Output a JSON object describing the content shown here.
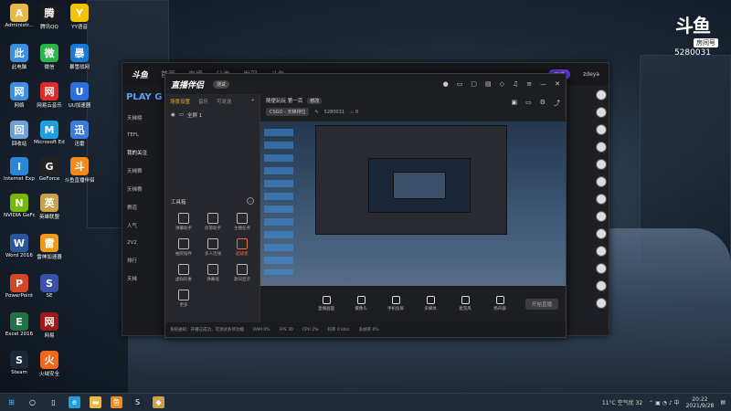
{
  "desktop": {
    "icons": [
      {
        "label": "Administr...",
        "icon": "user-folder-icon",
        "color": "#e9b94a"
      },
      {
        "label": "腾讯QQ",
        "icon": "qq-penguin-icon",
        "color": "#1a1a1a"
      },
      {
        "label": "YY语音",
        "icon": "yy-voice-icon",
        "color": "#f5c400"
      },
      {
        "label": "此电脑",
        "icon": "computer-icon",
        "color": "#3d8fe0"
      },
      {
        "label": "微信",
        "icon": "wechat-icon",
        "color": "#2ab54b"
      },
      {
        "label": "暴雪战网",
        "icon": "battlenet-icon",
        "color": "#1a78d6"
      },
      {
        "label": "网络",
        "icon": "network-icon",
        "color": "#3d8fe0"
      },
      {
        "label": "网易云音乐",
        "icon": "netease-music-icon",
        "color": "#e02b2b"
      },
      {
        "label": "UU加速器",
        "icon": "booster-icon",
        "color": "#2b6fe0"
      },
      {
        "label": "回收站",
        "icon": "recycle-bin-icon",
        "color": "#6fa3d6"
      },
      {
        "label": "Microsoft Edge",
        "icon": "edge-icon",
        "color": "#1f9ede"
      },
      {
        "label": "迅雷",
        "icon": "thunder-icon",
        "color": "#3a7be0"
      },
      {
        "label": "Internet Explorer",
        "icon": "ie-icon",
        "color": "#2a86d8"
      },
      {
        "label": "GeForce",
        "icon": "camera-app-icon",
        "color": "#222"
      },
      {
        "label": "斗鱼直播伴侣",
        "icon": "douyu-app-icon",
        "color": "#f08a1c"
      },
      {
        "label": "NVIDIA GeForce",
        "icon": "nvidia-icon",
        "color": "#76b900"
      },
      {
        "label": "英雄联盟",
        "icon": "lol-icon",
        "color": "#c9a24b"
      },
      {
        "label": "Word 2016",
        "icon": "word-icon",
        "color": "#2b579a"
      },
      {
        "label": "雷神加速器",
        "icon": "leishen-icon",
        "color": "#f09a1c"
      },
      {
        "label": "PowerPoint",
        "icon": "powerpoint-icon",
        "color": "#d24726"
      },
      {
        "label": "SE",
        "icon": "se-app-icon",
        "color": "#3a52a8"
      },
      {
        "label": "Excel 2016",
        "icon": "excel-icon",
        "color": "#217346"
      },
      {
        "label": "网易",
        "icon": "spider-app-icon",
        "color": "#a01818"
      },
      {
        "label": "Steam",
        "icon": "steam-icon",
        "color": "#1b2838"
      },
      {
        "label": "火绒安全",
        "icon": "huorong-icon",
        "color": "#f0681c"
      }
    ]
  },
  "douyu_logo": {
    "mark": "斗鱼",
    "room_label": "房间号",
    "room_number": "5280031"
  },
  "douyu_client": {
    "brand": "斗鱼",
    "nav": [
      "首页",
      "直播",
      "分类",
      "发现",
      "斗鱼"
    ],
    "live_button": "开播",
    "user": "zdeya",
    "play_banner": "PLAY G",
    "sidebar": [
      "天梯榜",
      "TEFL",
      "我的关注",
      "天梯赛",
      "天梯赛",
      "赛道",
      "人气",
      "2V2",
      "排行",
      "天梯"
    ]
  },
  "companion": {
    "brand": "直播伴侣",
    "badge": "测试",
    "left_tabs": [
      "场景设置",
      "音乐",
      "可发送"
    ],
    "scene": "全屏 1",
    "toolbox_title": "工具箱",
    "tools": [
      {
        "label": "弹幕助手",
        "hot": false
      },
      {
        "label": "房管助手",
        "hot": false
      },
      {
        "label": "主播任务",
        "hot": false
      },
      {
        "label": "抽奖插件",
        "hot": false
      },
      {
        "label": "多人连线",
        "hot": false
      },
      {
        "label": "超级麦",
        "hot": true
      },
      {
        "label": "虚拟形象",
        "hot": false
      },
      {
        "label": "弹幕墙",
        "hot": false
      },
      {
        "label": "歌词显示",
        "hot": false
      },
      {
        "label": "更多",
        "hot": false
      }
    ],
    "room_title": "随便玩玩 第一百",
    "room_edit": "修改",
    "category": "CSGO - 天梯排位",
    "room_id": "5280031",
    "bottom_tools": [
      "直播画面",
      "摄像头",
      "手机投屏",
      "多媒体",
      "麦克风",
      "扬声器"
    ],
    "start_button": "开始直播",
    "status_bar": [
      "RAM 0%",
      "FPS 30",
      "CPU 2%",
      "码率 0 kb/s",
      "丢帧率 0%",
      "FPS 30"
    ],
    "status_notice": "系统通知：开播已成功，可测试各项功能"
  },
  "taskbar": {
    "weather": "11°C 空气优 32",
    "time": "20:22",
    "date": "2021/9/28"
  }
}
